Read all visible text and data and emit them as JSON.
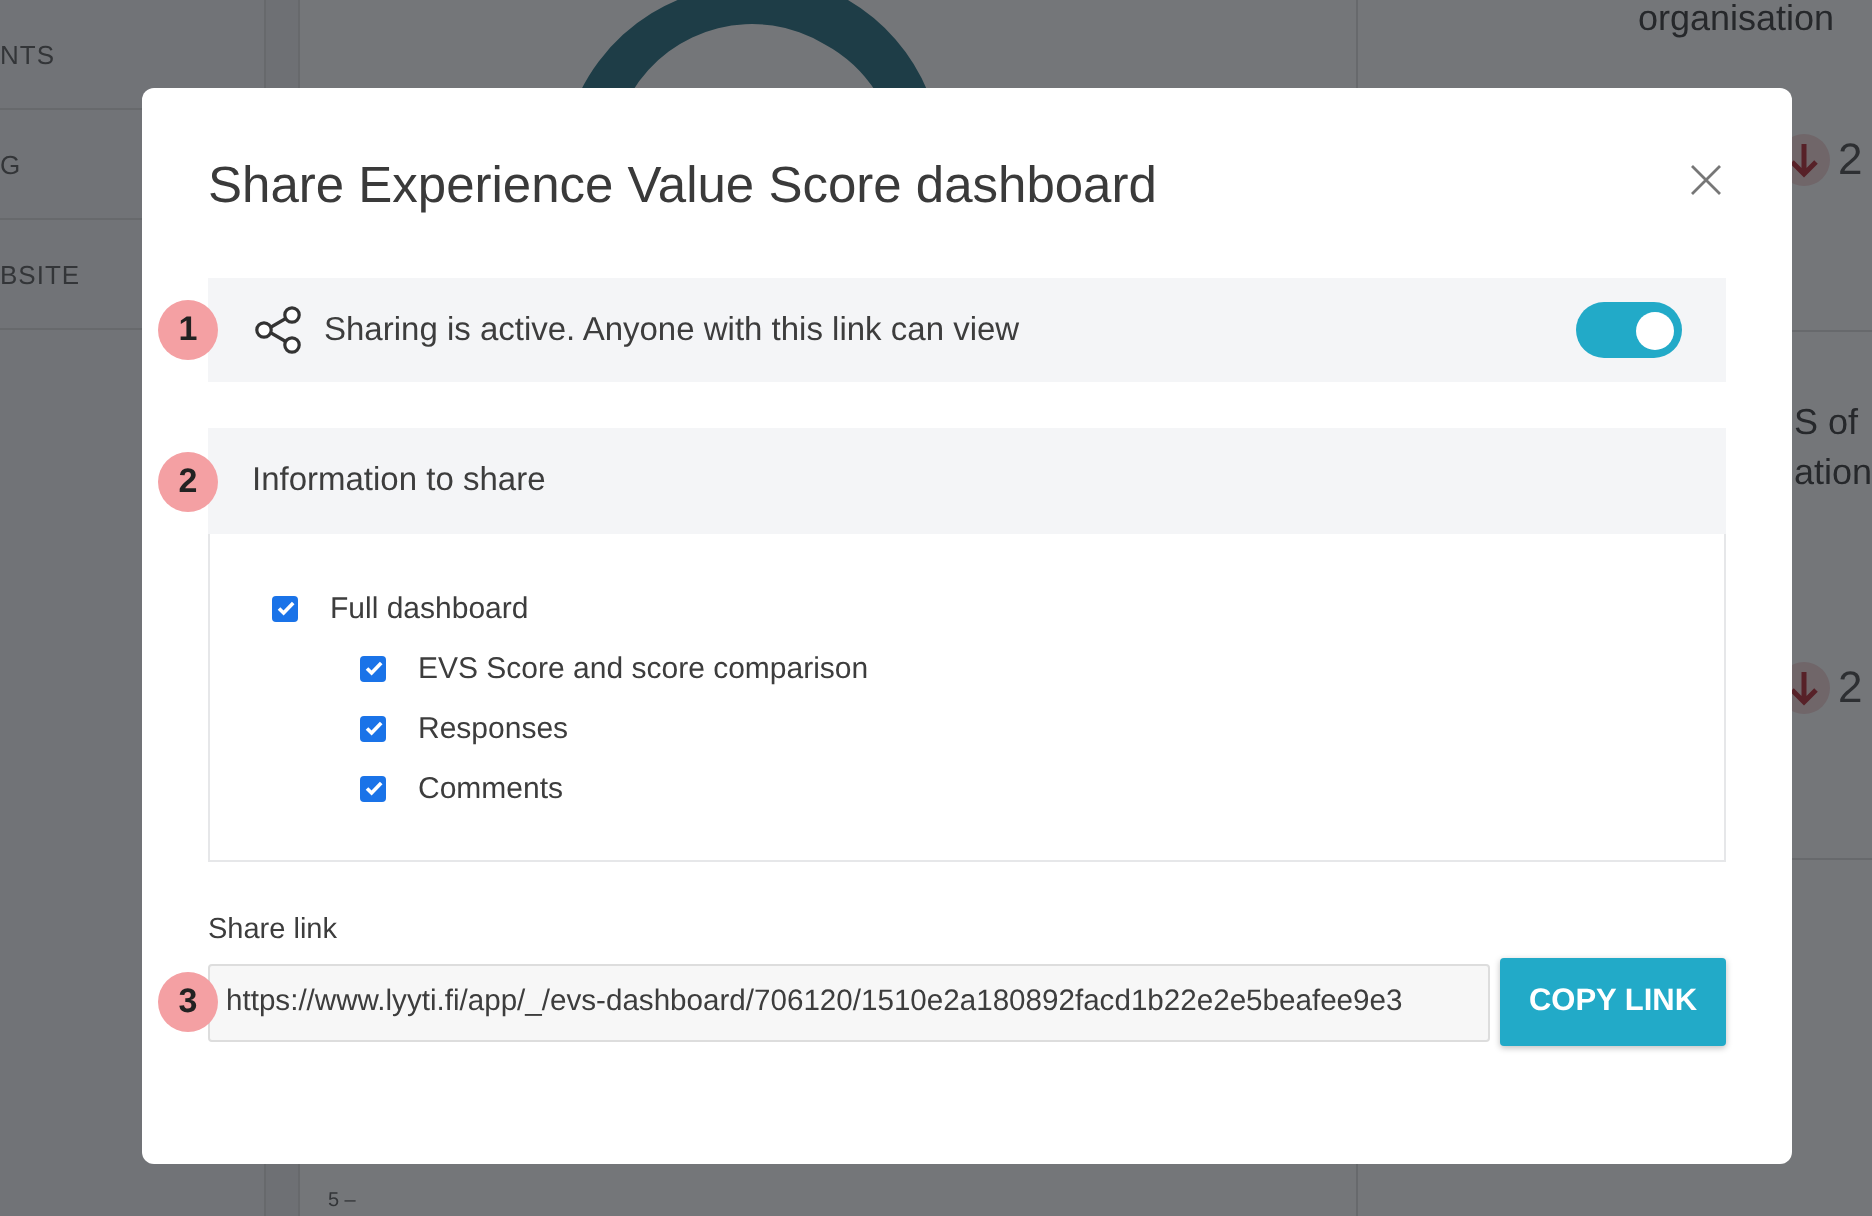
{
  "background": {
    "sidebar_items": [
      "NTS",
      "G",
      "BSITE"
    ],
    "right_cards": [
      {
        "title": "organisation",
        "trend": "2"
      },
      {
        "title_lines": [
          "S of",
          "ation"
        ],
        "trend": "2"
      }
    ],
    "axis_tick": "5 –"
  },
  "dialog": {
    "title": "Share Experience Value Score dashboard",
    "sharing": {
      "step": "1",
      "text": "Sharing is active. Anyone with this link can view",
      "on": true
    },
    "information": {
      "step": "2",
      "title": "Information to share",
      "options": [
        {
          "label": "Full dashboard",
          "checked": true,
          "children": [
            {
              "label": "EVS Score and score comparison",
              "checked": true
            },
            {
              "label": "Responses",
              "checked": true
            },
            {
              "label": "Comments",
              "checked": true
            }
          ]
        }
      ]
    },
    "share_link": {
      "step": "3",
      "label": "Share link",
      "value": "https://www.lyyti.fi/app/_/evs-dashboard/706120/1510e2a180892facd1b22e2e5beafee9e3",
      "button": "COPY LINK"
    }
  }
}
